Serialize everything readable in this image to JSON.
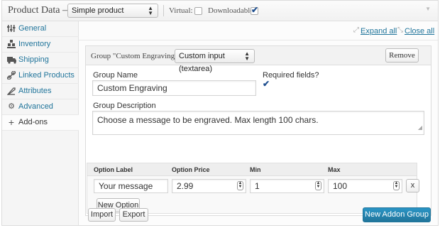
{
  "header": {
    "title": "Product Data —",
    "product_type": "Simple product",
    "virtual_label": "Virtual:",
    "downloadable_label": "Downloadable:",
    "virtual_checked": false,
    "downloadable_checked": true,
    "toggle_icon": "triangle-down-icon"
  },
  "sidebar": {
    "items": [
      {
        "label": "General",
        "icon": "sliders-icon",
        "active": false
      },
      {
        "label": "Inventory",
        "icon": "boxes-icon",
        "active": false
      },
      {
        "label": "Shipping",
        "icon": "truck-icon",
        "active": false
      },
      {
        "label": "Linked Products",
        "icon": "link-icon",
        "active": false
      },
      {
        "label": "Attributes",
        "icon": "tag-icon",
        "active": false
      },
      {
        "label": "Advanced",
        "icon": "gear-icon",
        "active": false
      },
      {
        "label": "Add-ons",
        "icon": "plus-icon",
        "active": true
      }
    ]
  },
  "main": {
    "expand_all": "Expand all",
    "close_all": "Close all",
    "group": {
      "title": "Group \"Custom Engraving\" —",
      "type": "Custom input (textarea)",
      "remove_label": "Remove",
      "name_label": "Group Name",
      "name_value": "Custom Engraving",
      "required_label": "Required fields?",
      "required_checked": true,
      "description_label": "Group Description",
      "description_value": "Choose a message to be engraved. Max length 100 chars.",
      "options": {
        "columns": [
          "Option Label",
          "Option Price",
          "Min",
          "Max"
        ],
        "rows": [
          {
            "label": "Your message",
            "price": "2.99",
            "min": "1",
            "max": "100"
          }
        ],
        "remove_option": "x",
        "new_option": "New Option"
      }
    },
    "import_label": "Import",
    "export_label": "Export",
    "new_group_label": "New Addon Group"
  },
  "colors": {
    "link": "#21759b",
    "primary": "#21759b"
  }
}
